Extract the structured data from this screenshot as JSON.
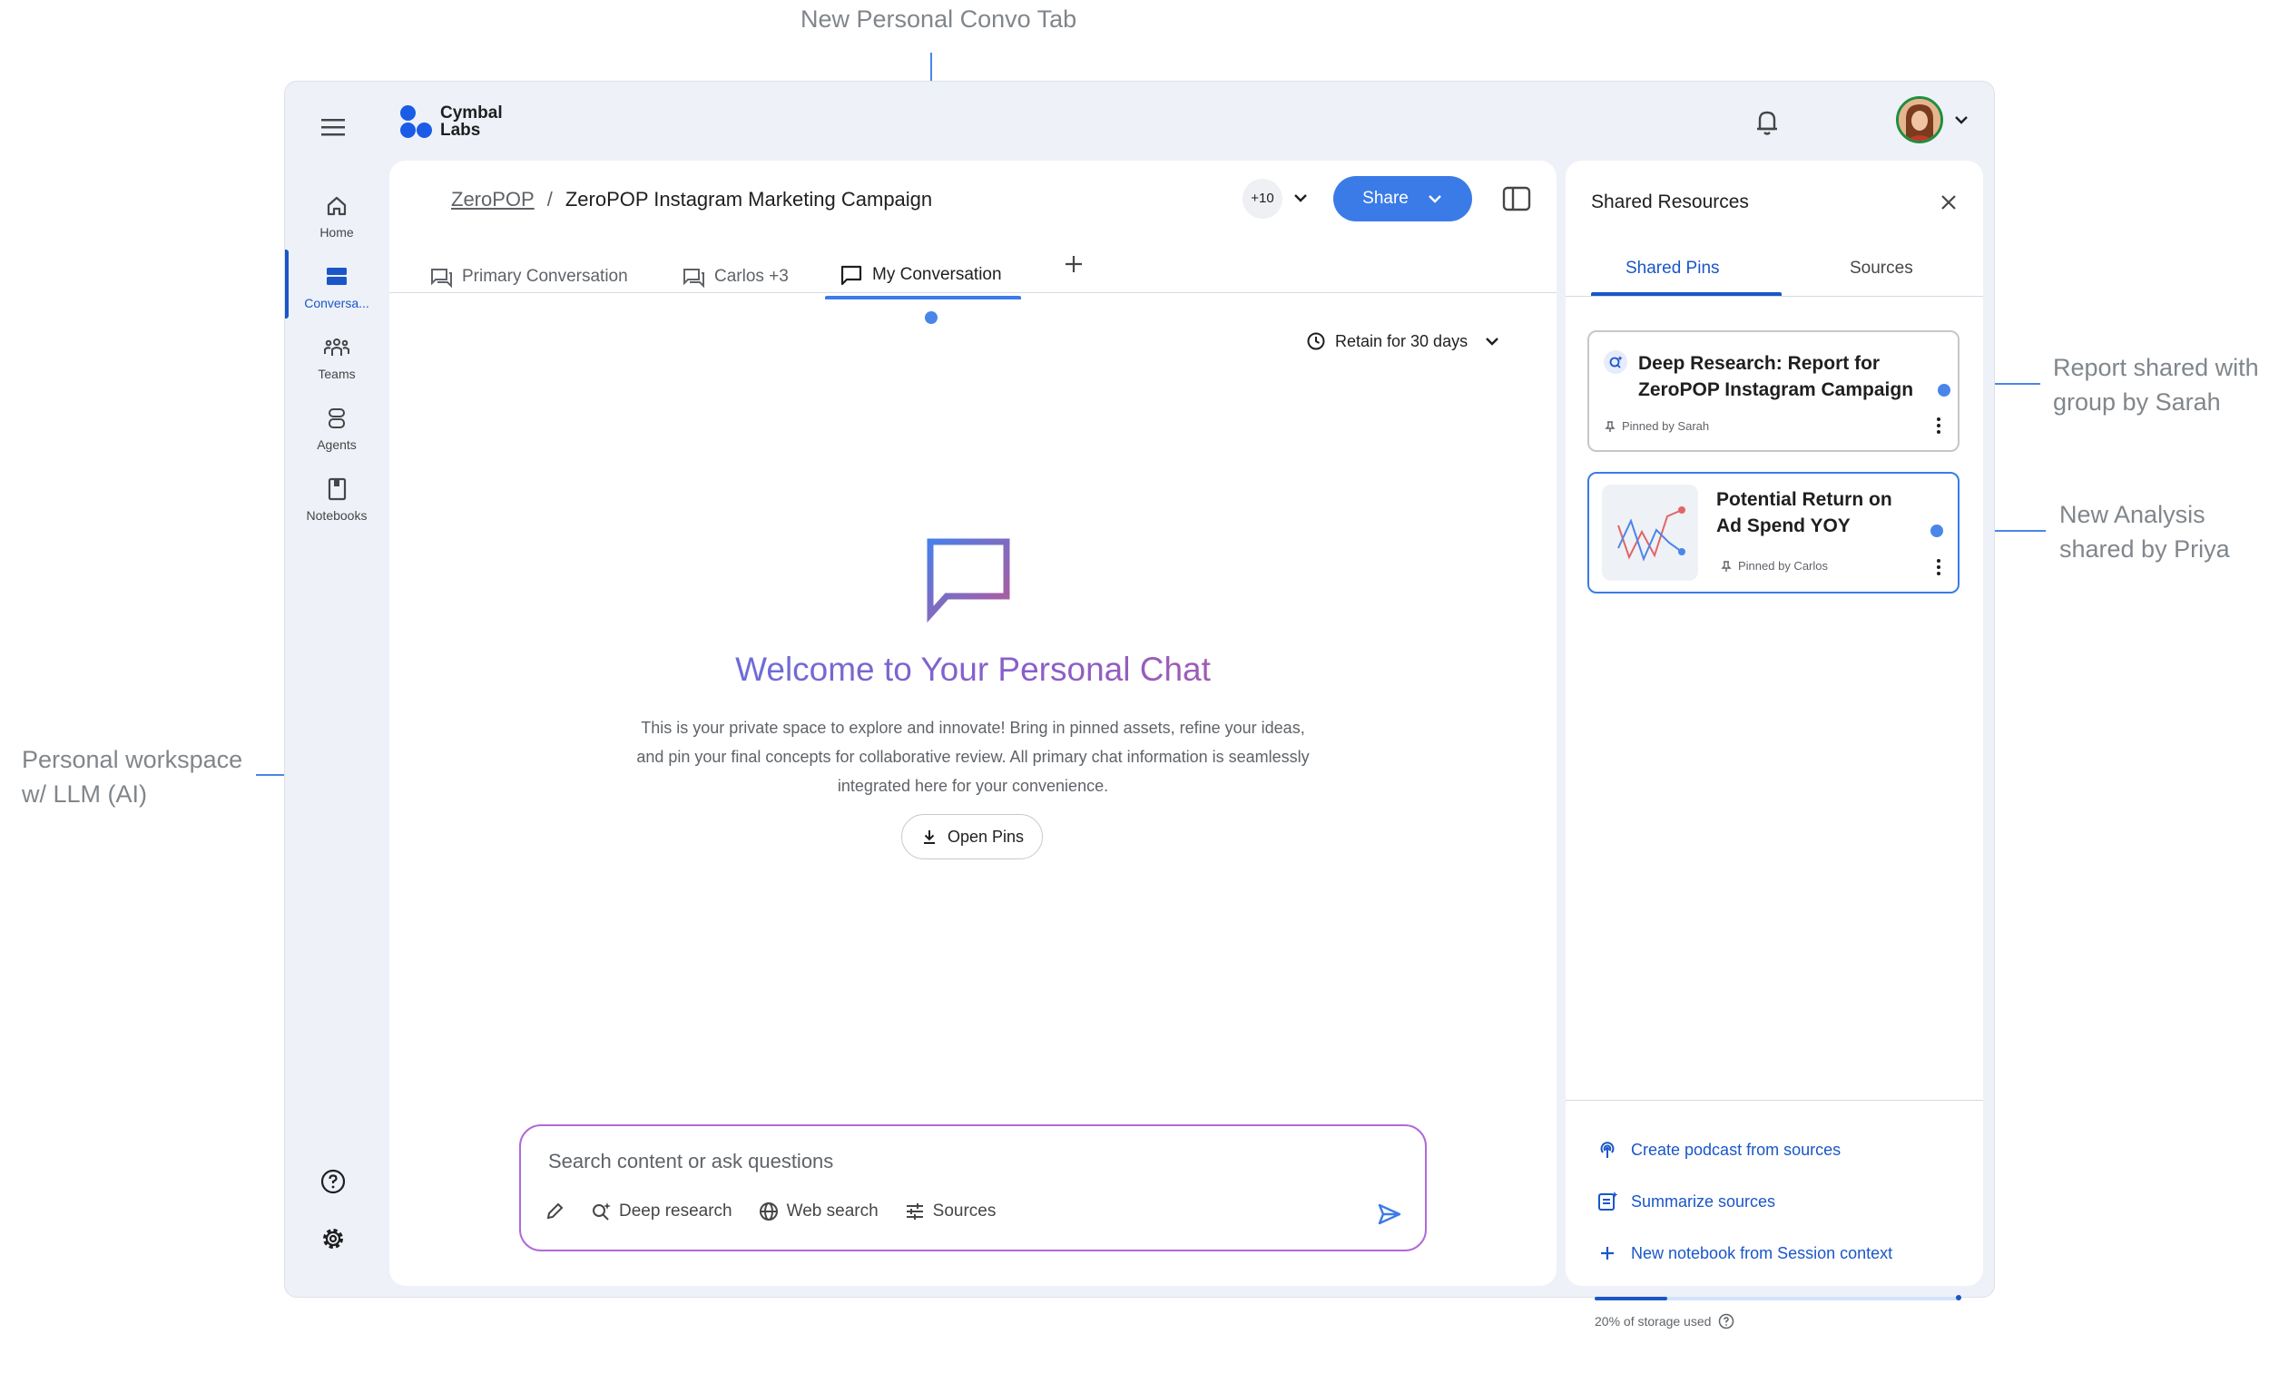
{
  "annotations": {
    "new_tab": "New Personal Convo Tab",
    "personal_workspace_l1": "Personal workspace",
    "personal_workspace_l2": "w/ LLM (AI)",
    "report_shared_l1": "Report shared with",
    "report_shared_l2": "group by Sarah",
    "new_analysis_l1": "New Analysis",
    "new_analysis_l2": "shared by Priya"
  },
  "logo": {
    "line1": "Cymbal",
    "line2": "Labs"
  },
  "rail": {
    "items": [
      {
        "label": "Home",
        "icon": "home-icon"
      },
      {
        "label": "Conversa...",
        "icon": "conversations-icon"
      },
      {
        "label": "Teams",
        "icon": "teams-icon"
      },
      {
        "label": "Agents",
        "icon": "agents-icon"
      },
      {
        "label": "Notebooks",
        "icon": "notebook-icon"
      }
    ],
    "active_index": 1
  },
  "breadcrumb": {
    "parent": "ZeroPOP",
    "separator": "/",
    "current": "ZeroPOP Instagram Marketing Campaign"
  },
  "header": {
    "members_count": "+10",
    "share_label": "Share"
  },
  "tabs": [
    {
      "label": "Primary Conversation"
    },
    {
      "label": "Carlos +3"
    },
    {
      "label": "My Conversation"
    }
  ],
  "retention": {
    "label": "Retain for 30 days"
  },
  "welcome": {
    "title": "Welcome to Your Personal Chat",
    "body": "This is your private space to explore and innovate! Bring in pinned assets, refine your ideas, and pin your final concepts for collaborative review. All primary chat information is seamlessly integrated here for your convenience.",
    "open_pins_label": "Open Pins"
  },
  "chat": {
    "placeholder": "Search content or ask questions",
    "tools": {
      "deep_research": "Deep research",
      "web_search": "Web search",
      "sources": "Sources"
    }
  },
  "right_panel": {
    "title": "Shared Resources",
    "tabs": {
      "shared_pins": "Shared Pins",
      "sources": "Sources"
    },
    "pins": [
      {
        "title_l1": "Deep Research: Report for",
        "title_l2": "ZeroPOP Instagram Campaign",
        "pinned_by": "Pinned by Sarah"
      },
      {
        "title_l1": "Potential Return on",
        "title_l2": "Ad Spend YOY",
        "pinned_by": "Pinned by Carlos"
      }
    ],
    "actions": {
      "podcast": "Create podcast from sources",
      "summarize": "Summarize sources",
      "notebook": "New notebook from Session context"
    },
    "storage": {
      "label": "20% of storage used",
      "used_fraction": 0.2
    }
  },
  "colors": {
    "accent": "#3b7be8",
    "link": "#1a56c8",
    "annotation": "#4a86e8"
  }
}
